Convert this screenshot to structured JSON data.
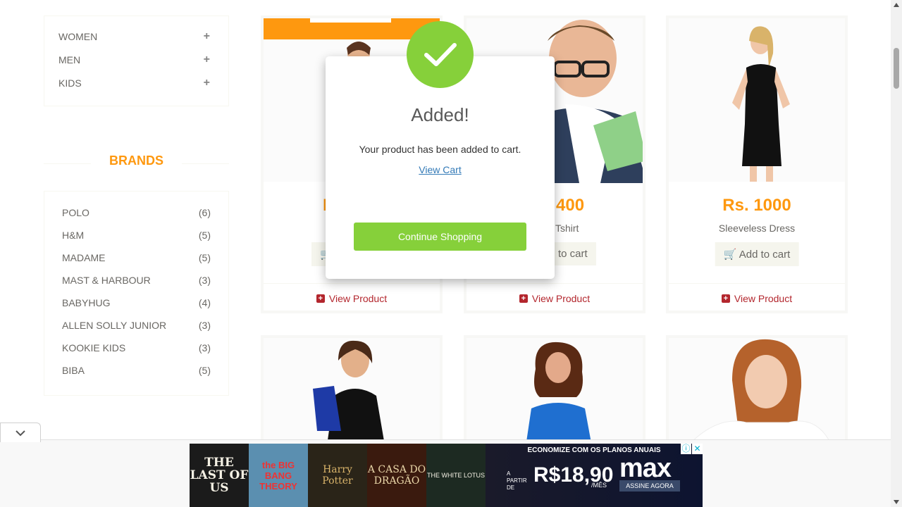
{
  "categories": [
    {
      "label": "WOMEN"
    },
    {
      "label": "MEN"
    },
    {
      "label": "KIDS"
    }
  ],
  "brands": {
    "title": "BRANDS",
    "items": [
      {
        "name": "POLO",
        "count": "(6)"
      },
      {
        "name": "H&M",
        "count": "(5)"
      },
      {
        "name": "MADAME",
        "count": "(5)"
      },
      {
        "name": "MAST & HARBOUR",
        "count": "(3)"
      },
      {
        "name": "BABYHUG",
        "count": "(4)"
      },
      {
        "name": "ALLEN SOLLY JUNIOR",
        "count": "(3)"
      },
      {
        "name": "KOOKIE KIDS",
        "count": "(3)"
      },
      {
        "name": "BIBA",
        "count": "(5)"
      }
    ]
  },
  "products": [
    {
      "price": "R",
      "name": "",
      "add_label": "",
      "view_label": "View Product"
    },
    {
      "price": "400",
      "name": "Tshirt",
      "add_label": "to cart",
      "view_label": "View Product"
    },
    {
      "price": "Rs. 1000",
      "name": "Sleeveless Dress",
      "add_label": "Add to cart",
      "view_label": "View Product"
    }
  ],
  "modal": {
    "title": "Added!",
    "message": "Your product has been added to cart.",
    "link": "View Cart",
    "button": "Continue Shopping"
  },
  "ad": {
    "tiles": [
      "THE LAST OF US",
      "the BIG BANG THEORY",
      "Harry Potter",
      "A CASA DO DRAGÃO",
      "THE WHITE LOTUS"
    ],
    "promo_top": "ECONOMIZE COM OS PLANOS ANUAIS",
    "promo_prefix": "A PARTIR DE",
    "promo_price": "R$18,90",
    "promo_period": "/MÊS",
    "brand": "max",
    "cta": "ASSINE AGORA"
  },
  "colors": {
    "accent": "#fe980f",
    "success": "#86d03a",
    "link": "#337ab7",
    "view": "#b3262d"
  }
}
